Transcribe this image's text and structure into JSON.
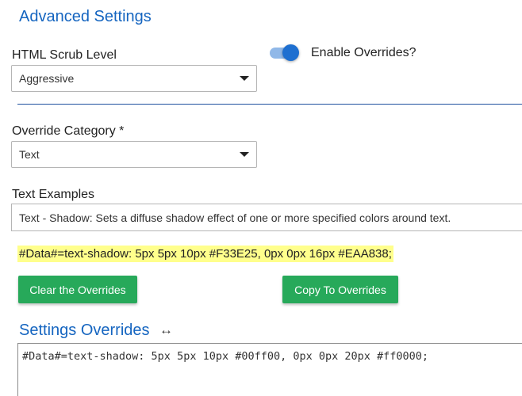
{
  "advanced": {
    "title": "Advanced Settings"
  },
  "scrub": {
    "label": "HTML Scrub Level",
    "selected": "Aggressive"
  },
  "overrides_toggle": {
    "label": "Enable Overrides?",
    "enabled": true,
    "track_color": "#90b8e8",
    "knob_color": "#1e6fd0"
  },
  "category": {
    "label": "Override Category *",
    "selected": "Text"
  },
  "examples": {
    "label": "Text Examples",
    "value": "Text - Shadow: Sets a diffuse shadow effect of one or more specified colors around text."
  },
  "sample_code": "#Data#=text-shadow: 5px 5px 10px #F33E25, 0px 0px 16px #EAA838;",
  "buttons": {
    "clear": "Clear the Overrides",
    "copy": "Copy To Overrides"
  },
  "settings_overrides": {
    "title": "Settings Overrides",
    "resize_icon": "horizontal-resize-icon",
    "content": "#Data#=text-shadow: 5px 5px 10px #00ff00, 0px 0px 20px #ff0000;"
  },
  "colors": {
    "accent": "#1565c0",
    "button": "#27a95a",
    "highlight": "#ffff8c"
  }
}
